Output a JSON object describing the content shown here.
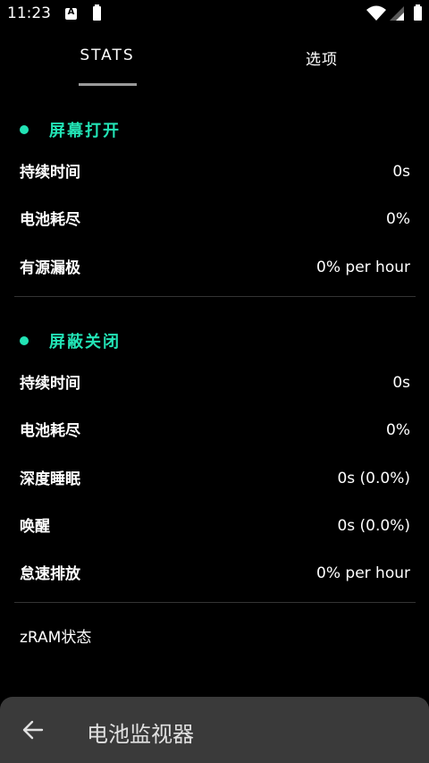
{
  "status_bar": {
    "time": "11:23",
    "notification_icon_letter": "A"
  },
  "tabs": [
    {
      "label": "STATS"
    },
    {
      "label": "选项"
    }
  ],
  "screen_on": {
    "title": "屏幕打开",
    "rows": [
      {
        "label": "持续时间",
        "value": "0s"
      },
      {
        "label": "电池耗尽",
        "value": "0%"
      },
      {
        "label": "有源漏极",
        "value": "0% per hour"
      }
    ]
  },
  "screen_off": {
    "title": "屏蔽关闭",
    "rows": [
      {
        "label": "持续时间",
        "value": "0s"
      },
      {
        "label": "电池耗尽",
        "value": "0%"
      },
      {
        "label": "深度睡眠",
        "value": "0s (0.0%)"
      },
      {
        "label": "唤醒",
        "value": "0s (0.0%)"
      },
      {
        "label": "怠速排放",
        "value": "0% per hour"
      }
    ]
  },
  "zram": {
    "label": "zRAM状态"
  },
  "bottom_bar": {
    "title": "电池监视器"
  },
  "colors": {
    "accent": "#22e3b5",
    "background": "#000000",
    "bottom_bar": "#3a3a3a"
  }
}
